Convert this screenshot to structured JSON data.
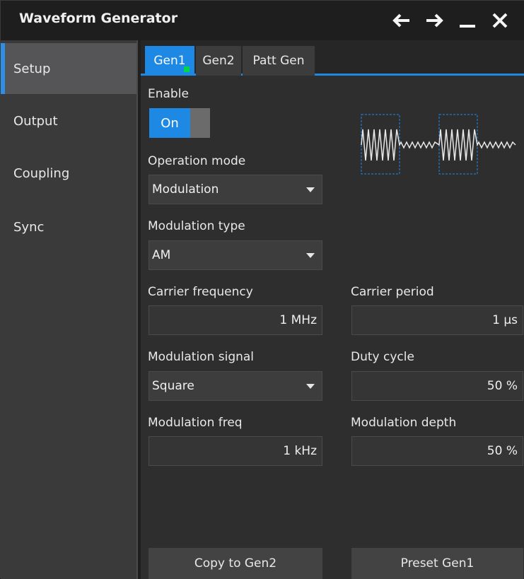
{
  "window": {
    "title": "Waveform Generator"
  },
  "titlebar_icons": [
    "arrow-left-icon",
    "arrow-right-icon",
    "minimize-icon",
    "close-icon"
  ],
  "sidebar": {
    "items": [
      {
        "label": "Setup",
        "active": true
      },
      {
        "label": "Output"
      },
      {
        "label": "Coupling"
      },
      {
        "label": "Sync"
      }
    ]
  },
  "tabs": [
    {
      "label": "Gen1",
      "active": true
    },
    {
      "label": "Gen2"
    },
    {
      "label": "Patt Gen"
    }
  ],
  "form": {
    "enable_label": "Enable",
    "enable_value": "On",
    "operation_mode_label": "Operation mode",
    "operation_mode_value": "Modulation",
    "modulation_type_label": "Modulation type",
    "modulation_type_value": "AM",
    "carrier_frequency_label": "Carrier frequency",
    "carrier_frequency_value": "1 MHz",
    "carrier_period_label": "Carrier period",
    "carrier_period_value": "1 µs",
    "modulation_signal_label": "Modulation signal",
    "modulation_signal_value": "Square",
    "duty_cycle_label": "Duty cycle",
    "duty_cycle_value": "50 %",
    "modulation_freq_label": "Modulation freq",
    "modulation_freq_value": "1 kHz",
    "modulation_depth_label": "Modulation depth",
    "modulation_depth_value": "50 %"
  },
  "buttons": {
    "copy": "Copy to Gen2",
    "preset": "Preset Gen1"
  },
  "colors": {
    "accent": "#1e88e5",
    "active_indicator": "#00d64b",
    "background": "#2e2e2e"
  }
}
